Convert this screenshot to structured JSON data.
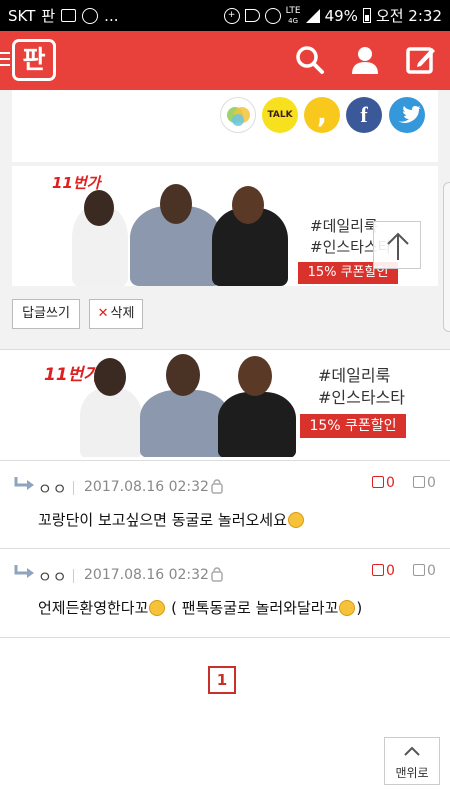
{
  "status_bar": {
    "carrier": "SKT",
    "carrier_app": "판",
    "more": "...",
    "network": "LTE",
    "network_sub": "4G",
    "battery": "49%",
    "time": "오전 2:32",
    "icons": [
      "pan-app-icon",
      "gallery-icon",
      "talk-icon",
      "data-saver-icon",
      "mute-icon",
      "alarm-icon",
      "signal-icon",
      "battery-icon"
    ]
  },
  "header": {
    "logo": "판",
    "icons": [
      "menu-icon",
      "search-icon",
      "user-icon",
      "write-icon"
    ],
    "color": "#e8413b"
  },
  "share": {
    "buttons": [
      {
        "name": "kakaostory",
        "label": "",
        "color": "#ffffff"
      },
      {
        "name": "kakaotalk",
        "label": "TALK",
        "color": "#f7e01e"
      },
      {
        "name": "kakaopage",
        "label": ",",
        "color": "#f8c81c"
      },
      {
        "name": "facebook",
        "label": "f",
        "color": "#3b5998"
      },
      {
        "name": "twitter",
        "label": "t",
        "color": "#3498db"
      }
    ]
  },
  "banner": {
    "brand": "11번가",
    "tags": [
      "#데일리룩",
      "#인스타스타"
    ],
    "coupon": "15% 쿠폰할인"
  },
  "actions": {
    "reply": "답글쓰기",
    "delete": "삭제"
  },
  "comments": [
    {
      "author": "ㅇㅇ",
      "date": "2017.08.16 02:32",
      "text_before": "꼬랑단이 보고싶으면 동굴로 놀러오세요",
      "text_after": "",
      "up": "0",
      "down": "0"
    },
    {
      "author": "ㅇㅇ",
      "date": "2017.08.16 02:32",
      "text_before": "언제든환영한다꼬",
      "text_after": " ( 팬톡동굴로 놀러와달라꼬",
      "text_end": ")",
      "up": "0",
      "down": "0"
    }
  ],
  "pager": {
    "current": "1"
  },
  "top_button": {
    "label": "맨위로"
  }
}
